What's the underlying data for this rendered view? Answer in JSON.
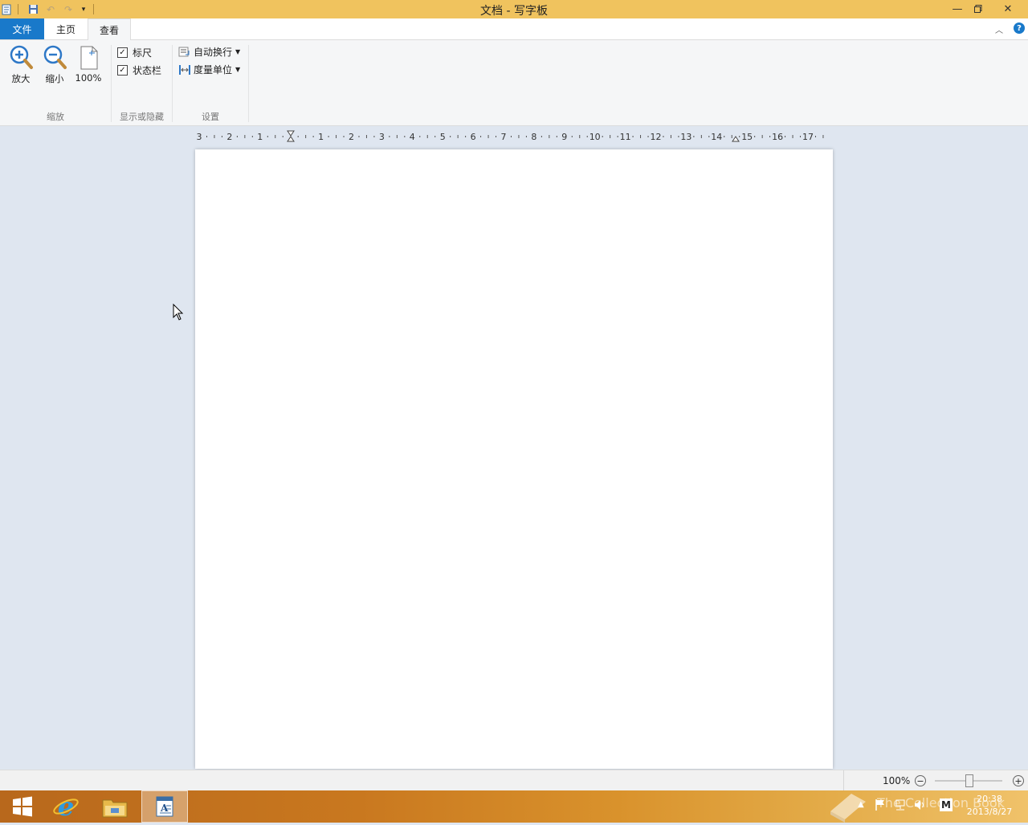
{
  "window": {
    "title": "文档 - 写字板"
  },
  "tabs": {
    "file": "文件",
    "home": "主页",
    "view": "查看"
  },
  "ribbon": {
    "zoom_group": {
      "label": "缩放",
      "zoom_in": "放大",
      "zoom_out": "缩小",
      "hundred": "100%"
    },
    "show_group": {
      "label": "显示或隐藏",
      "ruler": "标尺",
      "ruler_checked": true,
      "statusbar": "状态栏",
      "statusbar_checked": true
    },
    "settings_group": {
      "label": "设置",
      "word_wrap": "自动换行",
      "measure_unit": "度量单位"
    }
  },
  "ruler": {
    "labels": [
      "3",
      "2",
      "1",
      "",
      "1",
      "2",
      "3",
      "4",
      "5",
      "6",
      "7",
      "8",
      "9",
      "10",
      "11",
      "12",
      "13",
      "14",
      "15",
      "16",
      "17"
    ]
  },
  "statusbar": {
    "zoom": "100%"
  },
  "taskbar": {
    "time": "20:38",
    "date": "2013/8/27",
    "watermark": "The Collection Book"
  }
}
